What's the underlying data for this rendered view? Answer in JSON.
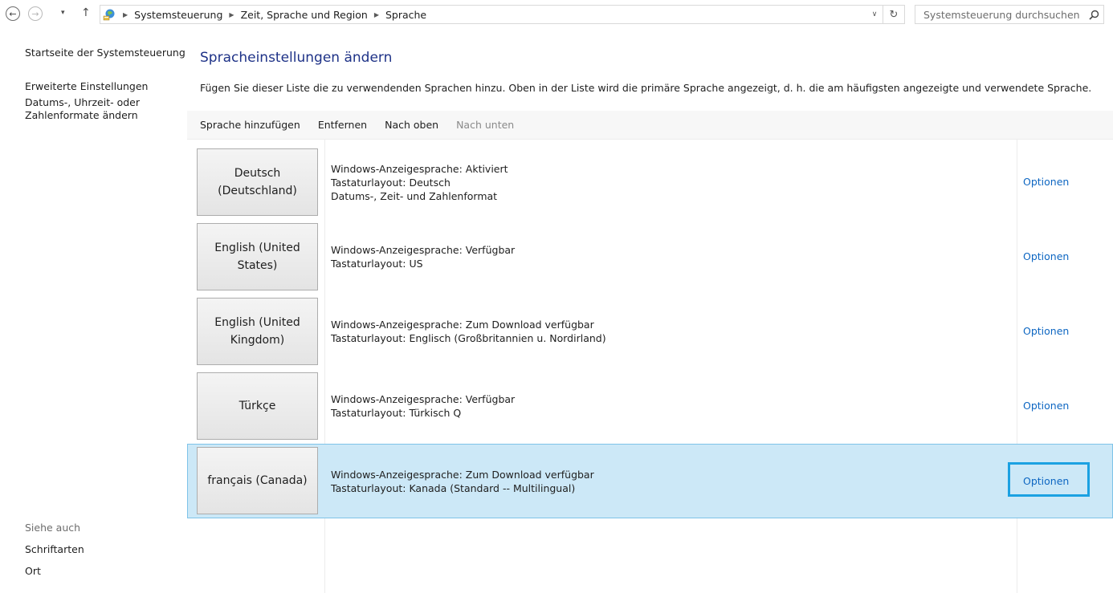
{
  "nav": {
    "back_glyph": "←",
    "forward_glyph": "→",
    "recent_glyph": "▾",
    "up_glyph": "↑"
  },
  "address": {
    "breadcrumbs": [
      "Systemsteuerung",
      "Zeit, Sprache und Region",
      "Sprache"
    ],
    "dropdown_glyph": "∨",
    "refresh_glyph": "↻"
  },
  "search": {
    "placeholder": "Systemsteuerung durchsuchen"
  },
  "sidebar": {
    "home": "Startseite der Systemsteuerung",
    "advanced": "Erweiterte Einstellungen",
    "formats_line1": "Datums-, Uhrzeit- oder",
    "formats_line2": "Zahlenformate ändern",
    "see_also": "Siehe auch",
    "fonts": "Schriftarten",
    "location": "Ort"
  },
  "main": {
    "title": "Spracheinstellungen ändern",
    "description": "Fügen Sie dieser Liste die zu verwendenden Sprachen hinzu. Oben in der Liste wird die primäre Sprache angezeigt, d. h. die am häufigsten angezeigte und verwendete Sprache.",
    "toolbar": {
      "add": "Sprache hinzufügen",
      "remove": "Entfernen",
      "up": "Nach oben",
      "down": "Nach unten"
    },
    "options_label": "Optionen",
    "languages": [
      {
        "tile_line1": "Deutsch",
        "tile_line2": "(Deutschland)",
        "details": [
          "Windows-Anzeigesprache: Aktiviert",
          "Tastaturlayout: Deutsch",
          "Datums-, Zeit- und Zahlenformat"
        ]
      },
      {
        "tile_line1": "English (United",
        "tile_line2": "States)",
        "details": [
          "Windows-Anzeigesprache: Verfügbar",
          "Tastaturlayout: US"
        ]
      },
      {
        "tile_line1": "English (United",
        "tile_line2": "Kingdom)",
        "details": [
          "Windows-Anzeigesprache: Zum Download verfügbar",
          "Tastaturlayout: Englisch (Großbritannien u. Nordirland)"
        ]
      },
      {
        "tile_line1": "Türkçe",
        "tile_line2": "",
        "details": [
          "Windows-Anzeigesprache: Verfügbar",
          "Tastaturlayout: Türkisch Q"
        ]
      },
      {
        "tile_line1": "français (Canada)",
        "tile_line2": "",
        "details": [
          "Windows-Anzeigesprache: Zum Download verfügbar",
          "Tastaturlayout: Kanada (Standard -- Multilingual)"
        ],
        "selected": true
      }
    ]
  },
  "colors": {
    "title_blue": "#1e3287",
    "link_blue": "#0d66c2",
    "selection_bg": "#cce8f7",
    "focus_border": "#1ba1e2"
  }
}
